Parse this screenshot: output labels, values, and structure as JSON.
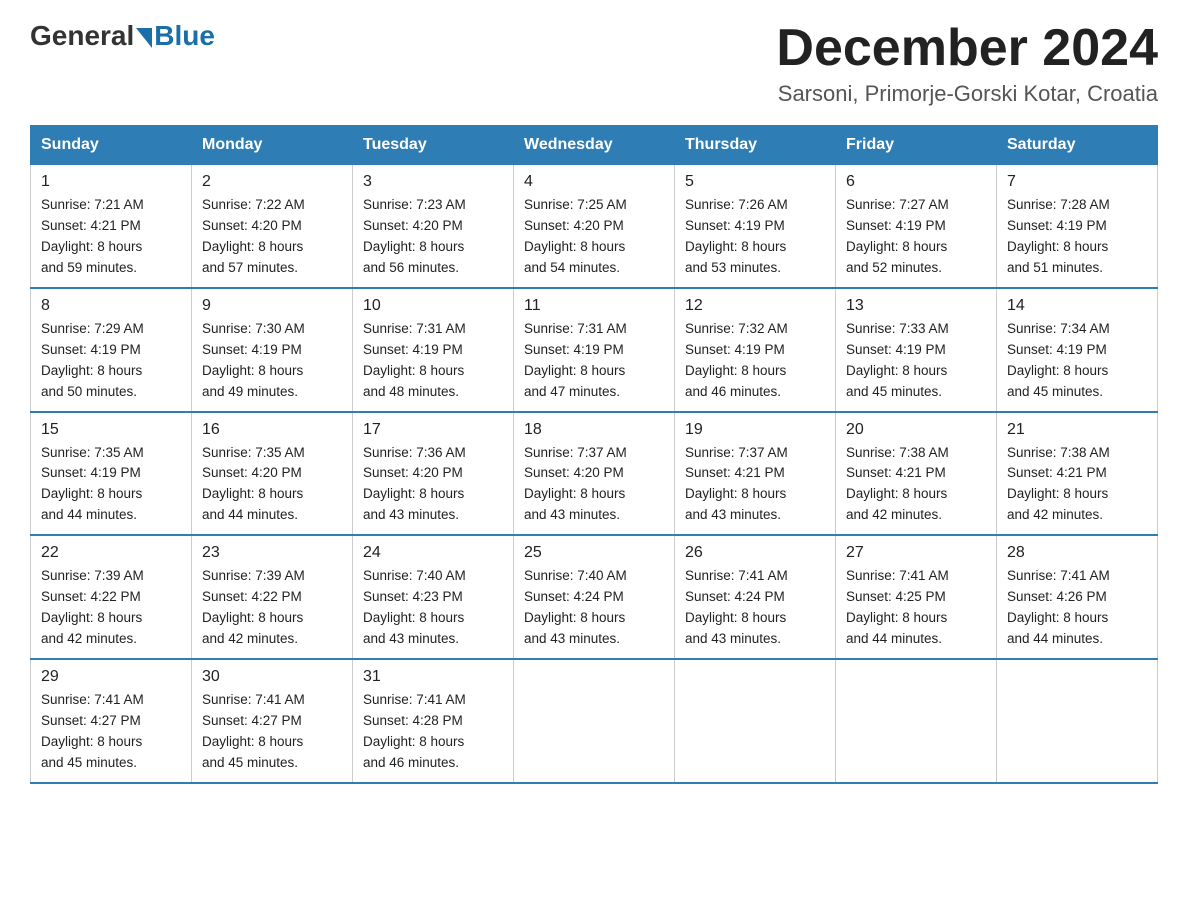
{
  "header": {
    "logo_general": "General",
    "logo_blue": "Blue",
    "month_title": "December 2024",
    "location": "Sarsoni, Primorje-Gorski Kotar, Croatia"
  },
  "weekdays": [
    "Sunday",
    "Monday",
    "Tuesday",
    "Wednesday",
    "Thursday",
    "Friday",
    "Saturday"
  ],
  "weeks": [
    [
      {
        "day": "1",
        "sunrise": "7:21 AM",
        "sunset": "4:21 PM",
        "daylight": "8 hours and 59 minutes."
      },
      {
        "day": "2",
        "sunrise": "7:22 AM",
        "sunset": "4:20 PM",
        "daylight": "8 hours and 57 minutes."
      },
      {
        "day": "3",
        "sunrise": "7:23 AM",
        "sunset": "4:20 PM",
        "daylight": "8 hours and 56 minutes."
      },
      {
        "day": "4",
        "sunrise": "7:25 AM",
        "sunset": "4:20 PM",
        "daylight": "8 hours and 54 minutes."
      },
      {
        "day": "5",
        "sunrise": "7:26 AM",
        "sunset": "4:19 PM",
        "daylight": "8 hours and 53 minutes."
      },
      {
        "day": "6",
        "sunrise": "7:27 AM",
        "sunset": "4:19 PM",
        "daylight": "8 hours and 52 minutes."
      },
      {
        "day": "7",
        "sunrise": "7:28 AM",
        "sunset": "4:19 PM",
        "daylight": "8 hours and 51 minutes."
      }
    ],
    [
      {
        "day": "8",
        "sunrise": "7:29 AM",
        "sunset": "4:19 PM",
        "daylight": "8 hours and 50 minutes."
      },
      {
        "day": "9",
        "sunrise": "7:30 AM",
        "sunset": "4:19 PM",
        "daylight": "8 hours and 49 minutes."
      },
      {
        "day": "10",
        "sunrise": "7:31 AM",
        "sunset": "4:19 PM",
        "daylight": "8 hours and 48 minutes."
      },
      {
        "day": "11",
        "sunrise": "7:31 AM",
        "sunset": "4:19 PM",
        "daylight": "8 hours and 47 minutes."
      },
      {
        "day": "12",
        "sunrise": "7:32 AM",
        "sunset": "4:19 PM",
        "daylight": "8 hours and 46 minutes."
      },
      {
        "day": "13",
        "sunrise": "7:33 AM",
        "sunset": "4:19 PM",
        "daylight": "8 hours and 45 minutes."
      },
      {
        "day": "14",
        "sunrise": "7:34 AM",
        "sunset": "4:19 PM",
        "daylight": "8 hours and 45 minutes."
      }
    ],
    [
      {
        "day": "15",
        "sunrise": "7:35 AM",
        "sunset": "4:19 PM",
        "daylight": "8 hours and 44 minutes."
      },
      {
        "day": "16",
        "sunrise": "7:35 AM",
        "sunset": "4:20 PM",
        "daylight": "8 hours and 44 minutes."
      },
      {
        "day": "17",
        "sunrise": "7:36 AM",
        "sunset": "4:20 PM",
        "daylight": "8 hours and 43 minutes."
      },
      {
        "day": "18",
        "sunrise": "7:37 AM",
        "sunset": "4:20 PM",
        "daylight": "8 hours and 43 minutes."
      },
      {
        "day": "19",
        "sunrise": "7:37 AM",
        "sunset": "4:21 PM",
        "daylight": "8 hours and 43 minutes."
      },
      {
        "day": "20",
        "sunrise": "7:38 AM",
        "sunset": "4:21 PM",
        "daylight": "8 hours and 42 minutes."
      },
      {
        "day": "21",
        "sunrise": "7:38 AM",
        "sunset": "4:21 PM",
        "daylight": "8 hours and 42 minutes."
      }
    ],
    [
      {
        "day": "22",
        "sunrise": "7:39 AM",
        "sunset": "4:22 PM",
        "daylight": "8 hours and 42 minutes."
      },
      {
        "day": "23",
        "sunrise": "7:39 AM",
        "sunset": "4:22 PM",
        "daylight": "8 hours and 42 minutes."
      },
      {
        "day": "24",
        "sunrise": "7:40 AM",
        "sunset": "4:23 PM",
        "daylight": "8 hours and 43 minutes."
      },
      {
        "day": "25",
        "sunrise": "7:40 AM",
        "sunset": "4:24 PM",
        "daylight": "8 hours and 43 minutes."
      },
      {
        "day": "26",
        "sunrise": "7:41 AM",
        "sunset": "4:24 PM",
        "daylight": "8 hours and 43 minutes."
      },
      {
        "day": "27",
        "sunrise": "7:41 AM",
        "sunset": "4:25 PM",
        "daylight": "8 hours and 44 minutes."
      },
      {
        "day": "28",
        "sunrise": "7:41 AM",
        "sunset": "4:26 PM",
        "daylight": "8 hours and 44 minutes."
      }
    ],
    [
      {
        "day": "29",
        "sunrise": "7:41 AM",
        "sunset": "4:27 PM",
        "daylight": "8 hours and 45 minutes."
      },
      {
        "day": "30",
        "sunrise": "7:41 AM",
        "sunset": "4:27 PM",
        "daylight": "8 hours and 45 minutes."
      },
      {
        "day": "31",
        "sunrise": "7:41 AM",
        "sunset": "4:28 PM",
        "daylight": "8 hours and 46 minutes."
      },
      null,
      null,
      null,
      null
    ]
  ]
}
